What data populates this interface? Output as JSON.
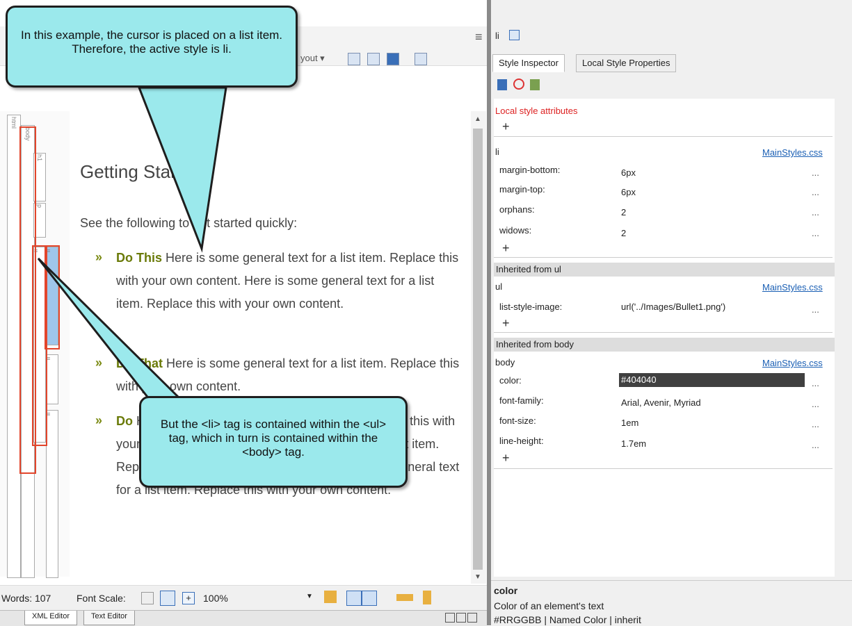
{
  "toolbar": {
    "layout_label": "yout ▾"
  },
  "tag_rail": {
    "html": "html",
    "body": "body",
    "h1": "h1",
    "p": "p",
    "ul": "≡",
    "li": "≡"
  },
  "document": {
    "heading": "Getting Started",
    "intro": "See the following to get started quickly:",
    "items": [
      {
        "bold": "Do This",
        "text": " Here is some general text for a list item. Replace this with your own content. Here is some general text for a list item. Replace this with your own content."
      },
      {
        "bold": "Do That",
        "text": " Here is some general text for a list item. Replace this with your own content."
      },
      {
        "bold": "Do",
        "text": " Here is some general text for a list item. Replace this with your own content. Here is some general text for a list item. Replace this with your own content. Here is some general text for a list item. Replace this with your own content."
      }
    ],
    "bullet": "»"
  },
  "status": {
    "words": "Words: 107",
    "font_scale_label": "Font Scale:",
    "zoom": "100%"
  },
  "editor_tabs": {
    "xml": "XML Editor",
    "text": "Text Editor"
  },
  "panel": {
    "header": "li",
    "tabs": [
      "Style Inspector",
      "Local Style Properties"
    ],
    "local_label": "Local style attributes",
    "sections": [
      {
        "selector": "li",
        "source": "MainStyles.css",
        "props": [
          {
            "name": "margin-bottom:",
            "value": "6px"
          },
          {
            "name": "margin-top:",
            "value": "6px"
          },
          {
            "name": "orphans:",
            "value": "2"
          },
          {
            "name": "widows:",
            "value": "2"
          }
        ]
      },
      {
        "header": "Inherited from ul",
        "selector": "ul",
        "source": "MainStyles.css",
        "props": [
          {
            "name": "list-style-image:",
            "value": "url('../Images/Bullet1.png')"
          }
        ]
      },
      {
        "header": "Inherited from body",
        "selector": "body",
        "source": "MainStyles.css",
        "props": [
          {
            "name": "color:",
            "value": "#404040"
          },
          {
            "name": "font-family:",
            "value": "Arial, Avenir, Myriad"
          },
          {
            "name": "font-size:",
            "value": "1em"
          },
          {
            "name": "line-height:",
            "value": "1.7em"
          }
        ]
      }
    ],
    "dots": "...",
    "plus": "+"
  },
  "description": {
    "title": "color",
    "line1": "Color of an element's text",
    "line2": "#RRGGBB | Named Color | inherit"
  },
  "callouts": {
    "top": "In this example, the cursor is placed on a list item. Therefore, the active style is li.",
    "bottom": "But the <li> tag is contained within the <ul> tag, which in turn is contained within the <body> tag."
  },
  "colors": {
    "callout_fill": "#9be9ec",
    "highlight_box": "#e2452b",
    "link": "#1a5fb4",
    "bold_item": "#6a7a08"
  }
}
